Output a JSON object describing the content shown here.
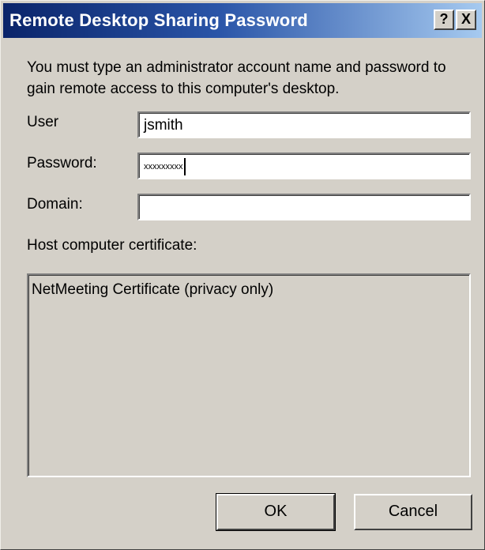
{
  "window": {
    "title": "Remote Desktop Sharing Password",
    "help_label": "?",
    "close_label": "X"
  },
  "instructions": "You must type an administrator account name and password to gain remote access to this computer's desktop.",
  "fields": {
    "user": {
      "label": "User",
      "value": "jsmith"
    },
    "password": {
      "label": "Password:",
      "value": "xxxxxxxxx"
    },
    "domain": {
      "label": "Domain:",
      "value": ""
    }
  },
  "certificate": {
    "label": "Host computer certificate:",
    "items": [
      "NetMeeting Certificate (privacy only)"
    ]
  },
  "buttons": {
    "ok": "OK",
    "cancel": "Cancel"
  },
  "colors": {
    "titlebar_start": "#0a246a",
    "titlebar_end": "#a6caf0",
    "dialog_face": "#d4d0c8"
  }
}
